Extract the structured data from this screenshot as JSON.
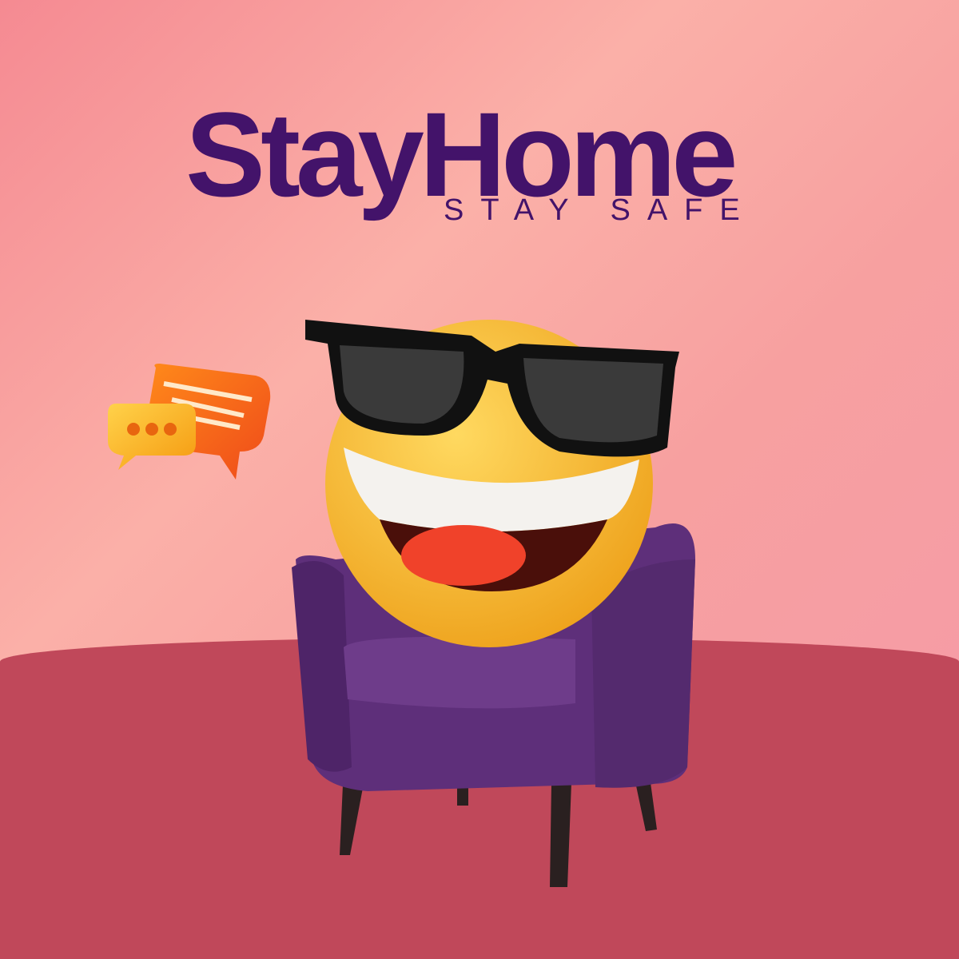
{
  "poster": {
    "title": "StayHome",
    "subtitle": "STAY SAFE",
    "colors": {
      "title": "#43136a",
      "floor": "#c0485a",
      "background": "#f7a0a0",
      "chair": "#5e2f7a",
      "emoji": "#f6b52a"
    },
    "illustration": [
      "smiling-emoji-with-sunglasses",
      "purple-armchair",
      "chat-bubbles"
    ]
  }
}
